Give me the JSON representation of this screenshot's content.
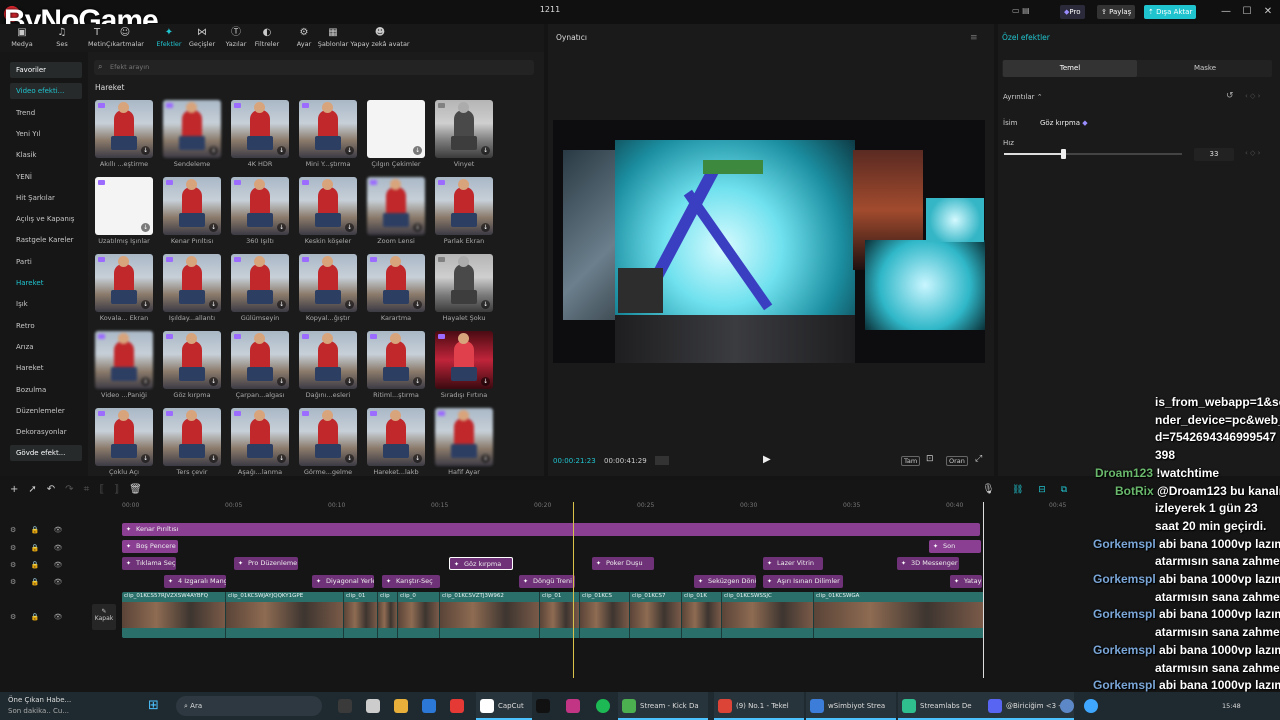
{
  "window": {
    "title": "1211",
    "pro_label": "Pro",
    "share_label": "Paylaş",
    "export_label": "Dışa Aktar"
  },
  "watermark": "ByNoGame",
  "toolbar": [
    "Medya",
    "Ses",
    "Metin",
    "Çıkartmalar",
    "Efektler",
    "Geçişler",
    "Yazılar",
    "Filtreler",
    "Ayar",
    "Şablonlar",
    "Yapay zekâ avatar"
  ],
  "nav": {
    "items": [
      "Favoriler",
      "Video efekti...",
      "Trend",
      "Yeni Yıl",
      "Klasik",
      "YENİ",
      "Hit Şarkılar",
      "Açılış ve Kapanış",
      "Rastgele Kareler",
      "Parti",
      "Hareket",
      "Işık",
      "Retro",
      "Arıza",
      "Hareket",
      "Bozulma",
      "Düzenlemeler",
      "Dekorasyonlar",
      "Gövde efekt..."
    ]
  },
  "effects": {
    "search_placeholder": "Efekt arayın",
    "section": "Hareket",
    "labels": [
      "Akıllı ...eştirme",
      "Sendeleme",
      "4K HDR",
      "Mini Y...ştırma",
      "Çılgın Çekimler",
      "Vinyet",
      "Uzatılmış Işınlar",
      "Kenar Pırıltısı",
      "360 Işıltı",
      "Keskin köşeler",
      "Zoom Lensi",
      "Parlak Ekran",
      "Kovala... Ekran",
      "Işılday...allantı",
      "Gülümseyin",
      "Kopyal...ğıştır",
      "Karartma",
      "Hayalet Şoku",
      "Video ...Paniği",
      "Göz kırpma",
      "Çarpan...algası",
      "Dağını...esleri",
      "Ritiml...ştırma",
      "Sıradışı Fırtına",
      "Çoklu Açı",
      "Ters çevir",
      "Aşağı...lanma",
      "Görme...gelme",
      "Hareket...lakb",
      "Hafif Ayar"
    ]
  },
  "player": {
    "header": "Oynatıcı",
    "current_time": "00:00:21:23",
    "total_time": "00:00:41:29",
    "btn_fit": "Tam",
    "btn_ratio": "Oran"
  },
  "inspector": {
    "header": "Özel efektler",
    "tabs": [
      "Temel",
      "Maske"
    ],
    "details_label": "Ayrıntılar",
    "name_label": "İsim",
    "name_value": "Göz kırpma",
    "speed_label": "Hız",
    "speed_value": "33",
    "speed_fraction": 0.33
  },
  "chat": {
    "lines": [
      {
        "name": "",
        "text": "is_from_webapp=1&se"
      },
      {
        "name": "",
        "text": "nder_device=pc&web_i"
      },
      {
        "name": "",
        "text": "d=7542694346999547"
      },
      {
        "name": "",
        "text": "398"
      },
      {
        "name": "Droam123",
        "text": "!watchtime"
      },
      {
        "name": "BotRix",
        "text": "@Droam123 bu kanalı"
      },
      {
        "name": "",
        "text": "izleyerek 1 gün 23"
      },
      {
        "name": "",
        "text": "saat 20 min geçirdi."
      },
      {
        "name": "Gorkemspl",
        "text": "abi bana 1000vp lazım"
      },
      {
        "name": "",
        "text": "atarmısın sana zahmet"
      },
      {
        "name": "Gorkemspl",
        "text": "abi bana 1000vp lazım"
      },
      {
        "name": "",
        "text": "atarmısın sana zahmet"
      },
      {
        "name": "Gorkemspl",
        "text": "abi bana 1000vp lazım"
      },
      {
        "name": "",
        "text": "atarmısın sana zahmet"
      },
      {
        "name": "Gorkemspl",
        "text": "abi bana 1000vp lazım"
      },
      {
        "name": "",
        "text": "atarmısın sana zahmet"
      },
      {
        "name": "Gorkemspl",
        "text": "abi bana 1000vp lazım"
      }
    ]
  },
  "timeline": {
    "ticks": [
      "00:00",
      "00:05",
      "00:10",
      "00:15",
      "00:20",
      "00:25",
      "00:30",
      "00:35",
      "00:40",
      "00:45"
    ],
    "row1": [
      "Kenar Pırıltısı"
    ],
    "row2": [
      "Boş Pencere",
      "Son"
    ],
    "row3": [
      "Tıklama Seç",
      "Pro Düzenleme",
      "Göz kırpma",
      "Poker Duşu",
      "Lazer Vitrin",
      "3D Messenger"
    ],
    "row4": [
      "4 Izgaralı Mang",
      "Diyagonal Yerle",
      "Karıştır-Seç",
      "Döngü Treni",
      "Seküzgen Dönü",
      "Aşırı Isınan Dilimler",
      "Yatay"
    ],
    "video_clips": [
      "clip_01KCS57RJVZXSW4AYBFQ",
      "clip_01KCSWJAYJQQKY1GPE",
      "clip_01",
      "clip",
      "clip_0",
      "clip_01KCSVZTJ3W962",
      "clip_01",
      "clip_01KCS",
      "clip_01KCS7",
      "clip_01K",
      "clip_01KCSWSSJC",
      "clip_01KCSWGA"
    ],
    "cover_label": "Kapak"
  },
  "taskbar": {
    "news_title": "Öne Çıkan Habe...",
    "news_sub": "Son dakika.. Cu...",
    "search": "Ara",
    "apps": [
      "CapCut",
      "Stream - Kick Da",
      "(9) No.1 - Tekel",
      "wSimbiyot Strea",
      "Streamlabs De",
      "@Biriciğim <3 -"
    ],
    "clock": "15:48"
  }
}
